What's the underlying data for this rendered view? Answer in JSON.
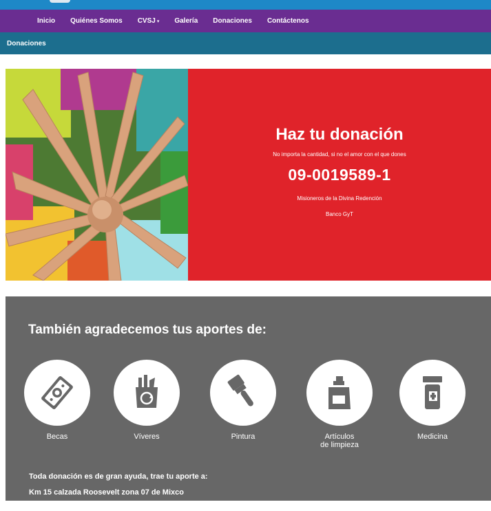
{
  "nav": {
    "items": [
      "Inicio",
      "Quiénes Somos",
      "CVSJ",
      "Galería",
      "Donaciones",
      "Contáctenos"
    ],
    "dropdown_caret": "▾"
  },
  "breadcrumb": "Donaciones",
  "hero": {
    "title": "Haz tu donación",
    "subtitle": "No importa la cantidad, si no el amor con el que dones",
    "account_number": "09-0019589-1",
    "account_holder": "Misioneros de la Divina Redención",
    "bank": "Banco GyT"
  },
  "contributions": {
    "title": "También agradecemos tus aportes de:",
    "items": [
      {
        "label": "Becas",
        "icon": "money-icon"
      },
      {
        "label": "Víveres",
        "icon": "groceries-icon"
      },
      {
        "label": "Pintura",
        "icon": "paintbrush-icon"
      },
      {
        "label_line1": "Artículos",
        "label_line2": "de limpieza",
        "icon": "cleaning-bottle-icon"
      },
      {
        "label": "Medicina",
        "icon": "medicine-bottle-icon"
      }
    ],
    "note": "Toda donación es de gran ayuda, trae tu aporte a:",
    "address": "Km 15 calzada Roosevelt zona 07 de Mixco"
  },
  "colors": {
    "topbar": "#1e88c7",
    "nav": "#6a2d91",
    "subbar": "#1c6e8e",
    "hero_red": "#e0232a",
    "gray_panel": "#676767"
  }
}
